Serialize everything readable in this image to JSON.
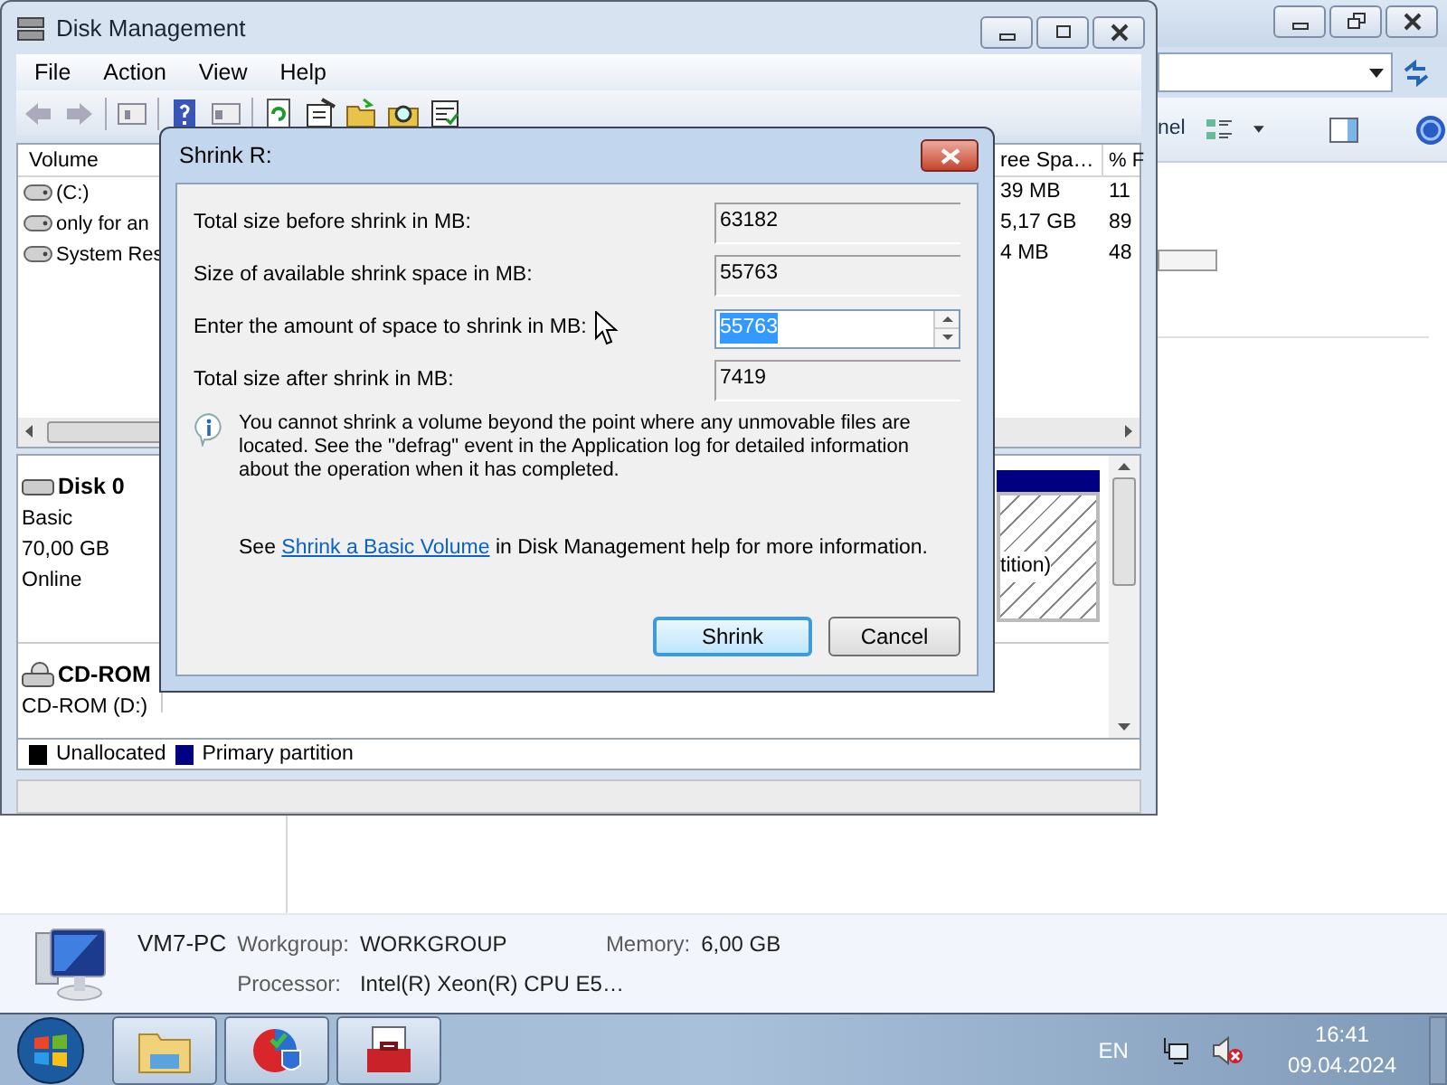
{
  "background_window": {
    "toolbar_text": "nel",
    "details": {
      "computer_name": "VM7-PC",
      "fields": [
        {
          "label": "Workgroup:",
          "value": "WORKGROUP"
        },
        {
          "label": "Memory:",
          "value": "6,00 GB"
        },
        {
          "label": "Processor:",
          "value": "Intel(R) Xeon(R) CPU E5…"
        }
      ]
    }
  },
  "disk_management": {
    "title": "Disk Management",
    "menu": [
      "File",
      "Action",
      "View",
      "Help"
    ],
    "volume_list": {
      "columns": [
        "Volume",
        "ree Spa…",
        "% F"
      ],
      "rows": [
        {
          "volume": "(C:)",
          "free_space": "39 MB",
          "percent_free": "11"
        },
        {
          "volume": "only for an",
          "free_space": "5,17 GB",
          "percent_free": "89"
        },
        {
          "volume": "System Res",
          "free_space": "4 MB",
          "percent_free": "48"
        }
      ]
    },
    "disks": [
      {
        "kind": "disk",
        "name": "Disk 0",
        "lines": [
          "Basic",
          "70,00 GB",
          "Online"
        ],
        "partition_label": "tition)"
      },
      {
        "kind": "cdrom",
        "name": "CD-ROM",
        "lines": [
          "CD-ROM (D:)"
        ]
      }
    ],
    "legend": [
      {
        "label": "Unallocated",
        "color": "#000000"
      },
      {
        "label": "Primary partition",
        "color": "#000080"
      }
    ]
  },
  "dialog": {
    "title": "Shrink R:",
    "fields": [
      {
        "kind": "readonly",
        "label": "Total size before shrink in MB:",
        "value": "63182"
      },
      {
        "kind": "readonly",
        "label": "Size of available shrink space in MB:",
        "value": "55763"
      },
      {
        "kind": "spinner",
        "label": "Enter the amount of space to shrink in MB:",
        "value": "55763",
        "text_selected": true
      },
      {
        "kind": "readonly",
        "label": "Total size after shrink in MB:",
        "value": "7419"
      }
    ],
    "info": "You cannot shrink a volume beyond the point where any unmovable files are located. See the \"defrag\" event in the Application log for detailed information about the operation when it has completed.",
    "help": {
      "before": "See",
      "link": "Shrink a Basic Volume",
      "after": "in Disk Management help for more information."
    },
    "buttons": [
      {
        "label": "Shrink",
        "default": true
      },
      {
        "label": "Cancel",
        "default": false
      }
    ]
  },
  "taskbar": {
    "language": "EN",
    "time": "16:41",
    "date": "09.04.2024"
  }
}
